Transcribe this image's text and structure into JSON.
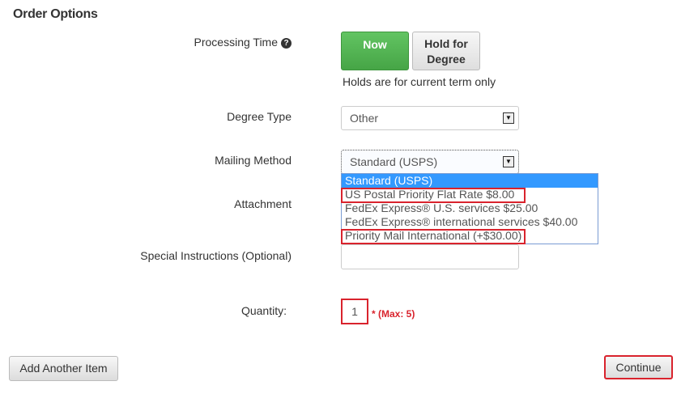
{
  "section_title": "Order Options",
  "processing_time": {
    "label": "Processing Time",
    "help_icon": "?",
    "now_label": "Now",
    "hold_label_line1": "Hold for",
    "hold_label_line2": "Degree",
    "hint": "Holds are for current term only"
  },
  "degree_type": {
    "label": "Degree Type",
    "value": "Other"
  },
  "mailing_method": {
    "label": "Mailing Method",
    "value": "Standard (USPS)",
    "options": [
      "Standard (USPS)",
      "US Postal Priority Flat Rate $8.00",
      "FedEx Express® U.S. services $25.00",
      "FedEx Express® international services $40.00",
      "Priority Mail International (+$30.00)"
    ]
  },
  "attachment": {
    "label": "Attachment"
  },
  "special_instructions": {
    "label": "Special Instructions (Optional)",
    "value": ""
  },
  "quantity": {
    "label": "Quantity:",
    "value": "1",
    "max_note": "* (Max: 5)"
  },
  "buttons": {
    "add_another": "Add Another Item",
    "continue": "Continue"
  },
  "colors": {
    "green": "#46a546",
    "highlight_red": "#d9232d",
    "selected_blue": "#3399ff"
  }
}
